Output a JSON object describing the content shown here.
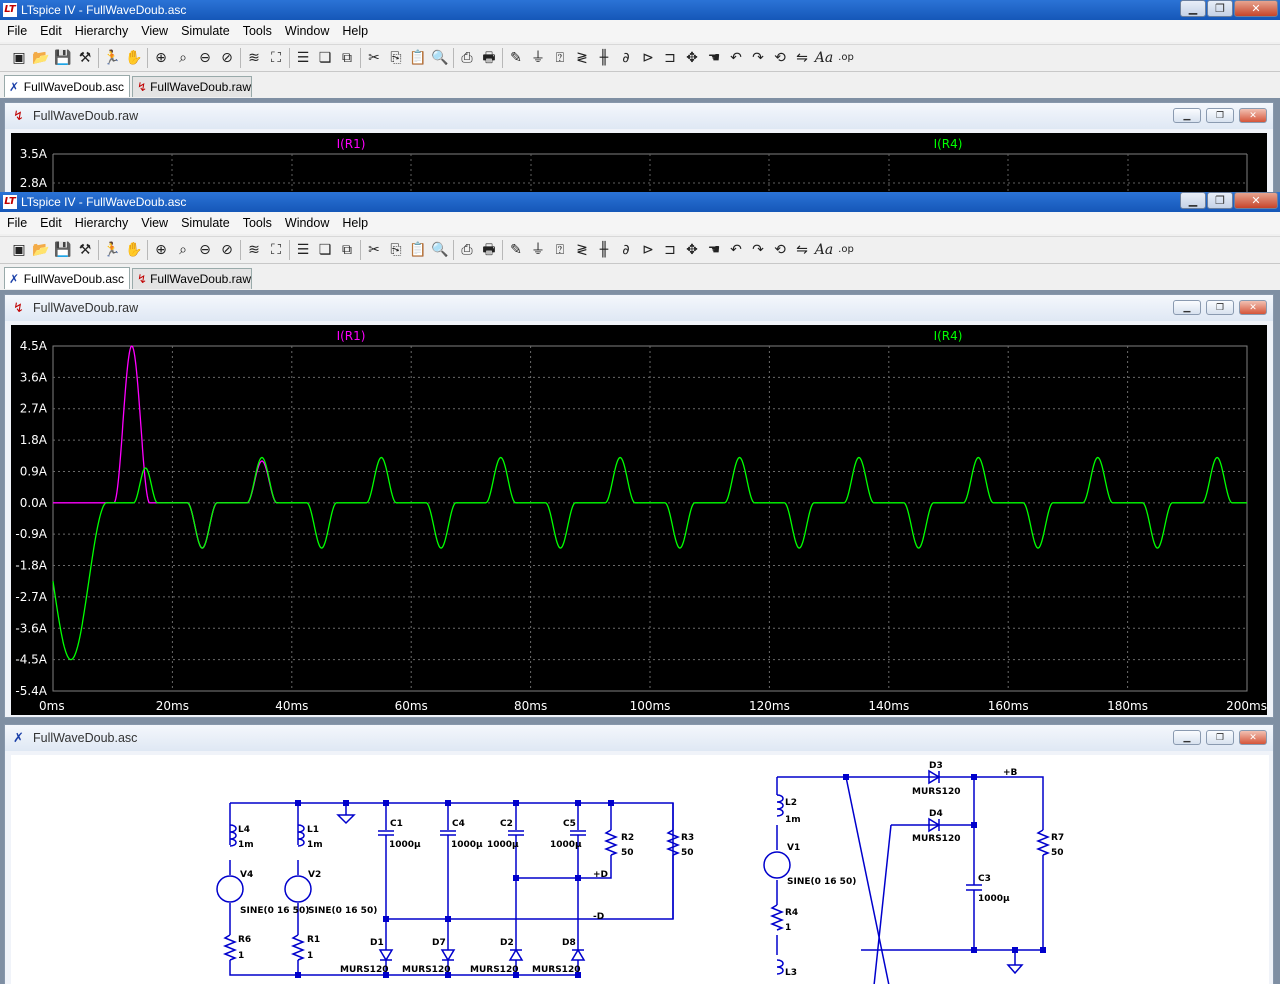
{
  "app": {
    "window_title": "LTspice IV - FullWaveDoub.asc",
    "menu": [
      "File",
      "Edit",
      "Hierarchy",
      "View",
      "Simulate",
      "Tools",
      "Window",
      "Help"
    ],
    "tabs": [
      {
        "label": "FullWaveDoub.asc",
        "active": true
      },
      {
        "label": "FullWaveDoub.raw",
        "active": false
      }
    ]
  },
  "toolbar": {
    "icons": [
      "new-schematic-icon",
      "open-icon",
      "save-icon",
      "control-panel-icon",
      "run-icon",
      "halt-icon",
      "zoom-in-icon",
      "zoom-pan-icon",
      "zoom-out-icon",
      "zoom-cancel-icon",
      "autorange-icon",
      "zoom-extents-icon",
      "tile-horizontal-icon",
      "cascade-icon",
      "close-windows-icon",
      "cut-icon",
      "copy-icon",
      "paste-icon",
      "find-icon",
      "print-setup-icon",
      "print-icon",
      "draw-wire-icon",
      "ground-icon",
      "label-net-icon",
      "resistor-icon",
      "capacitor-icon",
      "inductor-icon",
      "diode-icon",
      "component-icon",
      "move-icon",
      "drag-icon",
      "undo-icon",
      "redo-icon",
      "rotate-icon",
      "mirror-icon",
      "text-icon",
      "spice-directive-icon"
    ],
    "text_glyphs": {
      "text": "Aa",
      "spice": ".op"
    }
  },
  "plot_window": {
    "title": "FullWaveDoub.raw",
    "traces": [
      {
        "name": "I(R1)",
        "color": "#ff00ff"
      },
      {
        "name": "I(R4)",
        "color": "#00ff00"
      }
    ]
  },
  "back_plot": {
    "y_ticks": [
      "3.5A",
      "2.8A"
    ]
  },
  "chart_data": {
    "type": "line",
    "title": "",
    "xlabel": "",
    "ylabel": "",
    "xlim": [
      0,
      200
    ],
    "ylim": [
      -5.4,
      4.5
    ],
    "x_unit": "ms",
    "grid": true,
    "x_ticks": [
      "0ms",
      "20ms",
      "40ms",
      "60ms",
      "80ms",
      "100ms",
      "120ms",
      "140ms",
      "160ms",
      "180ms",
      "200ms"
    ],
    "y_ticks": [
      "4.5A",
      "3.6A",
      "2.7A",
      "1.8A",
      "0.9A",
      "0.0A",
      "-0.9A",
      "-1.8A",
      "-2.7A",
      "-3.6A",
      "-4.5A",
      "-5.4A"
    ],
    "y_tick_values": [
      4.5,
      3.6,
      2.7,
      1.8,
      0.9,
      0.0,
      -0.9,
      -1.8,
      -2.7,
      -3.6,
      -4.5,
      -5.4
    ],
    "legend": "top",
    "series": [
      {
        "name": "I(R1)",
        "color": "#ff00ff",
        "pulses": [
          {
            "center": 13.2,
            "half_width": 3,
            "peak": 4.5
          },
          {
            "center": 25,
            "half_width": 2.5,
            "peak": -1.3
          },
          {
            "center": 35,
            "half_width": 2.5,
            "peak": 1.2
          }
        ]
      },
      {
        "name": "I(R4)",
        "color": "#00ff00",
        "pulses": [
          {
            "center": 3,
            "half_width": 6,
            "peak": -4.5
          },
          {
            "center": 15.5,
            "half_width": 2,
            "peak": 1.0
          },
          {
            "center": 25,
            "half_width": 2.5,
            "peak": -1.3
          },
          {
            "center": 35,
            "half_width": 2.5,
            "peak": 1.3
          },
          {
            "center": 45,
            "half_width": 2.5,
            "peak": -1.3
          },
          {
            "center": 55,
            "half_width": 2.5,
            "peak": 1.3
          },
          {
            "center": 65,
            "half_width": 2.5,
            "peak": -1.3
          },
          {
            "center": 75,
            "half_width": 2.5,
            "peak": 1.3
          },
          {
            "center": 85,
            "half_width": 2.5,
            "peak": -1.3
          },
          {
            "center": 95,
            "half_width": 2.5,
            "peak": 1.3
          },
          {
            "center": 105,
            "half_width": 2.5,
            "peak": -1.3
          },
          {
            "center": 115,
            "half_width": 2.5,
            "peak": 1.3
          },
          {
            "center": 125,
            "half_width": 2.5,
            "peak": -1.3
          },
          {
            "center": 135,
            "half_width": 2.5,
            "peak": 1.3
          },
          {
            "center": 145,
            "half_width": 2.5,
            "peak": -1.3
          },
          {
            "center": 155,
            "half_width": 2.5,
            "peak": 1.3
          },
          {
            "center": 165,
            "half_width": 2.5,
            "peak": -1.3
          },
          {
            "center": 175,
            "half_width": 2.5,
            "peak": 1.3
          },
          {
            "center": 185,
            "half_width": 2.5,
            "peak": -1.3
          },
          {
            "center": 195,
            "half_width": 2.5,
            "peak": 1.3
          }
        ]
      }
    ]
  },
  "schematic_window": {
    "title": "FullWaveDoub.asc",
    "labels": {
      "L4": "L4",
      "L1": "L1",
      "L2": "L2",
      "L3": "L3",
      "ind_val": "1m",
      "V4": "V4",
      "V2": "V2",
      "V1": "V1",
      "sine": "SINE(0 16 50)",
      "R6": "R6",
      "R1": "R1",
      "R4": "R4",
      "r_one": "1",
      "R2": "R2",
      "R3": "R3",
      "R7": "R7",
      "r_fifty": "50",
      "C1": "C1",
      "C4": "C4",
      "C2": "C2",
      "C5": "C5",
      "C3": "C3",
      "cap_val": "1000µ",
      "D1": "D1",
      "D7": "D7",
      "D2": "D2",
      "D8": "D8",
      "D3": "D3",
      "D4": "D4",
      "diode": "MURS120",
      "plusD": "+D",
      "minusD": "-D",
      "plusB": "+B"
    }
  }
}
